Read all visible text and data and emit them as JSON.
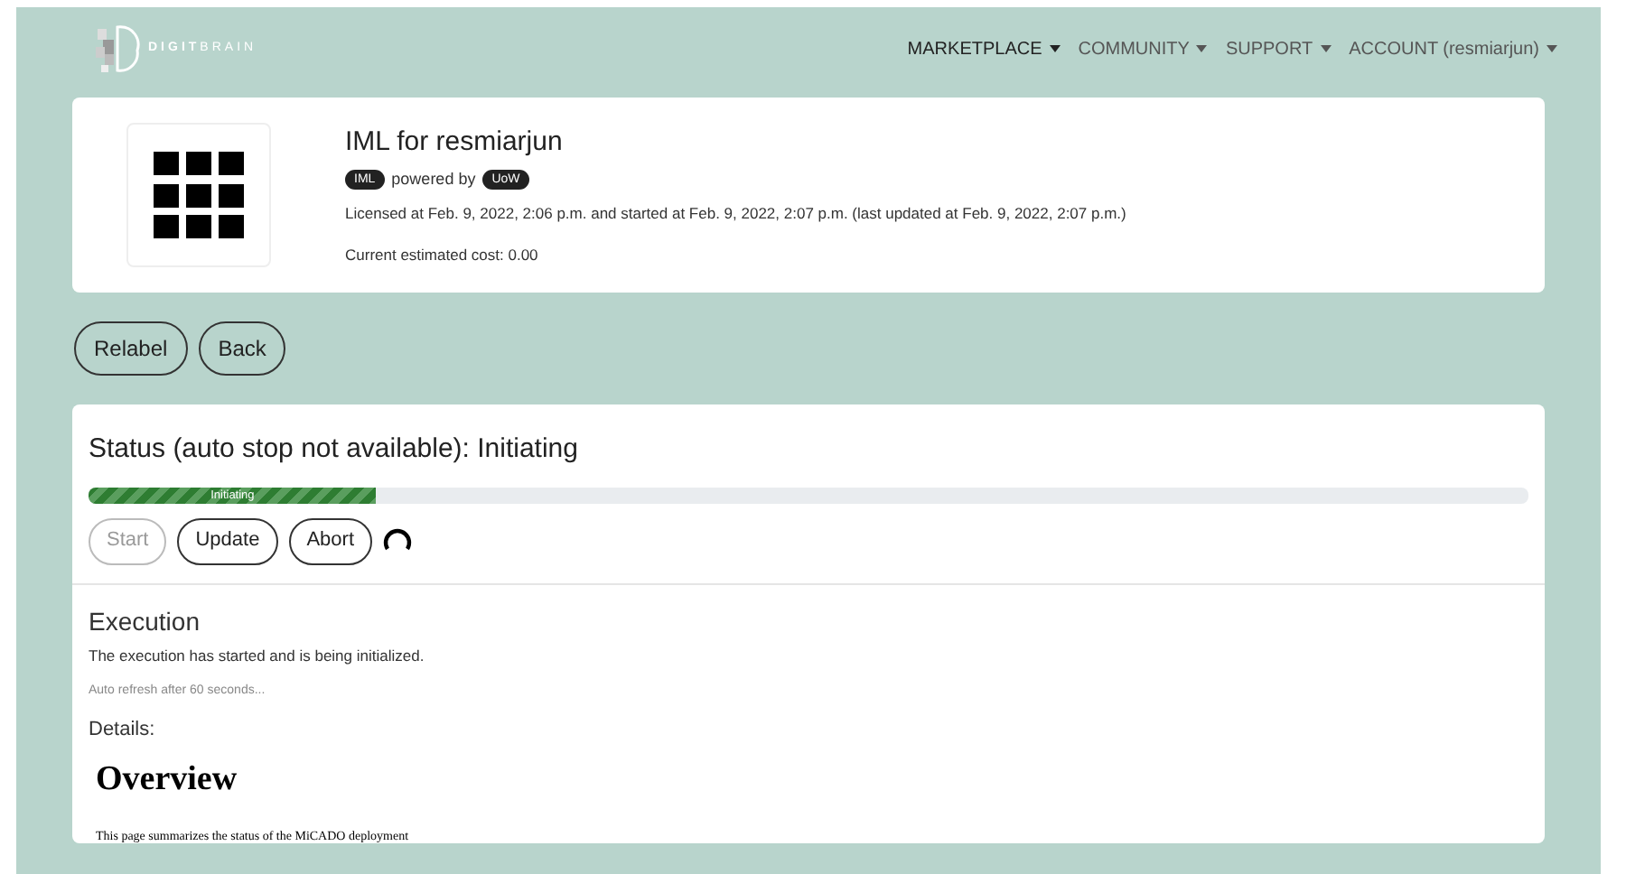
{
  "brand": "**DIGIT**BRAIN",
  "nav": [
    {
      "label": "MARKETPLACE",
      "selected": true
    },
    {
      "label": "COMMUNITY",
      "selected": false
    },
    {
      "label": "SUPPORT",
      "selected": false
    },
    {
      "label": "ACCOUNT (resmiarjun)",
      "selected": false
    }
  ],
  "app": {
    "title": "IML for resmiarjun",
    "tag": "IML",
    "powered_by": "powered by",
    "provider": "UoW",
    "license_info": "Licensed at Feb. 9, 2022, 2:06 p.m. and started at Feb. 9, 2022, 2:07 p.m. (last updated at Feb. 9, 2022, 2:07 p.m.)",
    "cost": "Current estimated cost: 0.00"
  },
  "actions": [
    "Relabel",
    "Back"
  ],
  "status": {
    "heading": "Status (auto stop not available): Initiating",
    "progress": {
      "label": "Initiating",
      "level": 0.2
    },
    "buttons": [
      {
        "label": "Start",
        "disabled": true
      },
      {
        "label": "Update",
        "disabled": false
      },
      {
        "label": "Abort",
        "disabled": false
      }
    ],
    "loading": true
  },
  "execution": {
    "heading": "Execution",
    "message": "The execution has started and is being initialized.",
    "refresh_note": "Auto refresh after 60 seconds...",
    "details_label": "Details:",
    "overview_heading": "Overview",
    "overview_text": "This page summarizes the status of the MiCADO deployment"
  }
}
